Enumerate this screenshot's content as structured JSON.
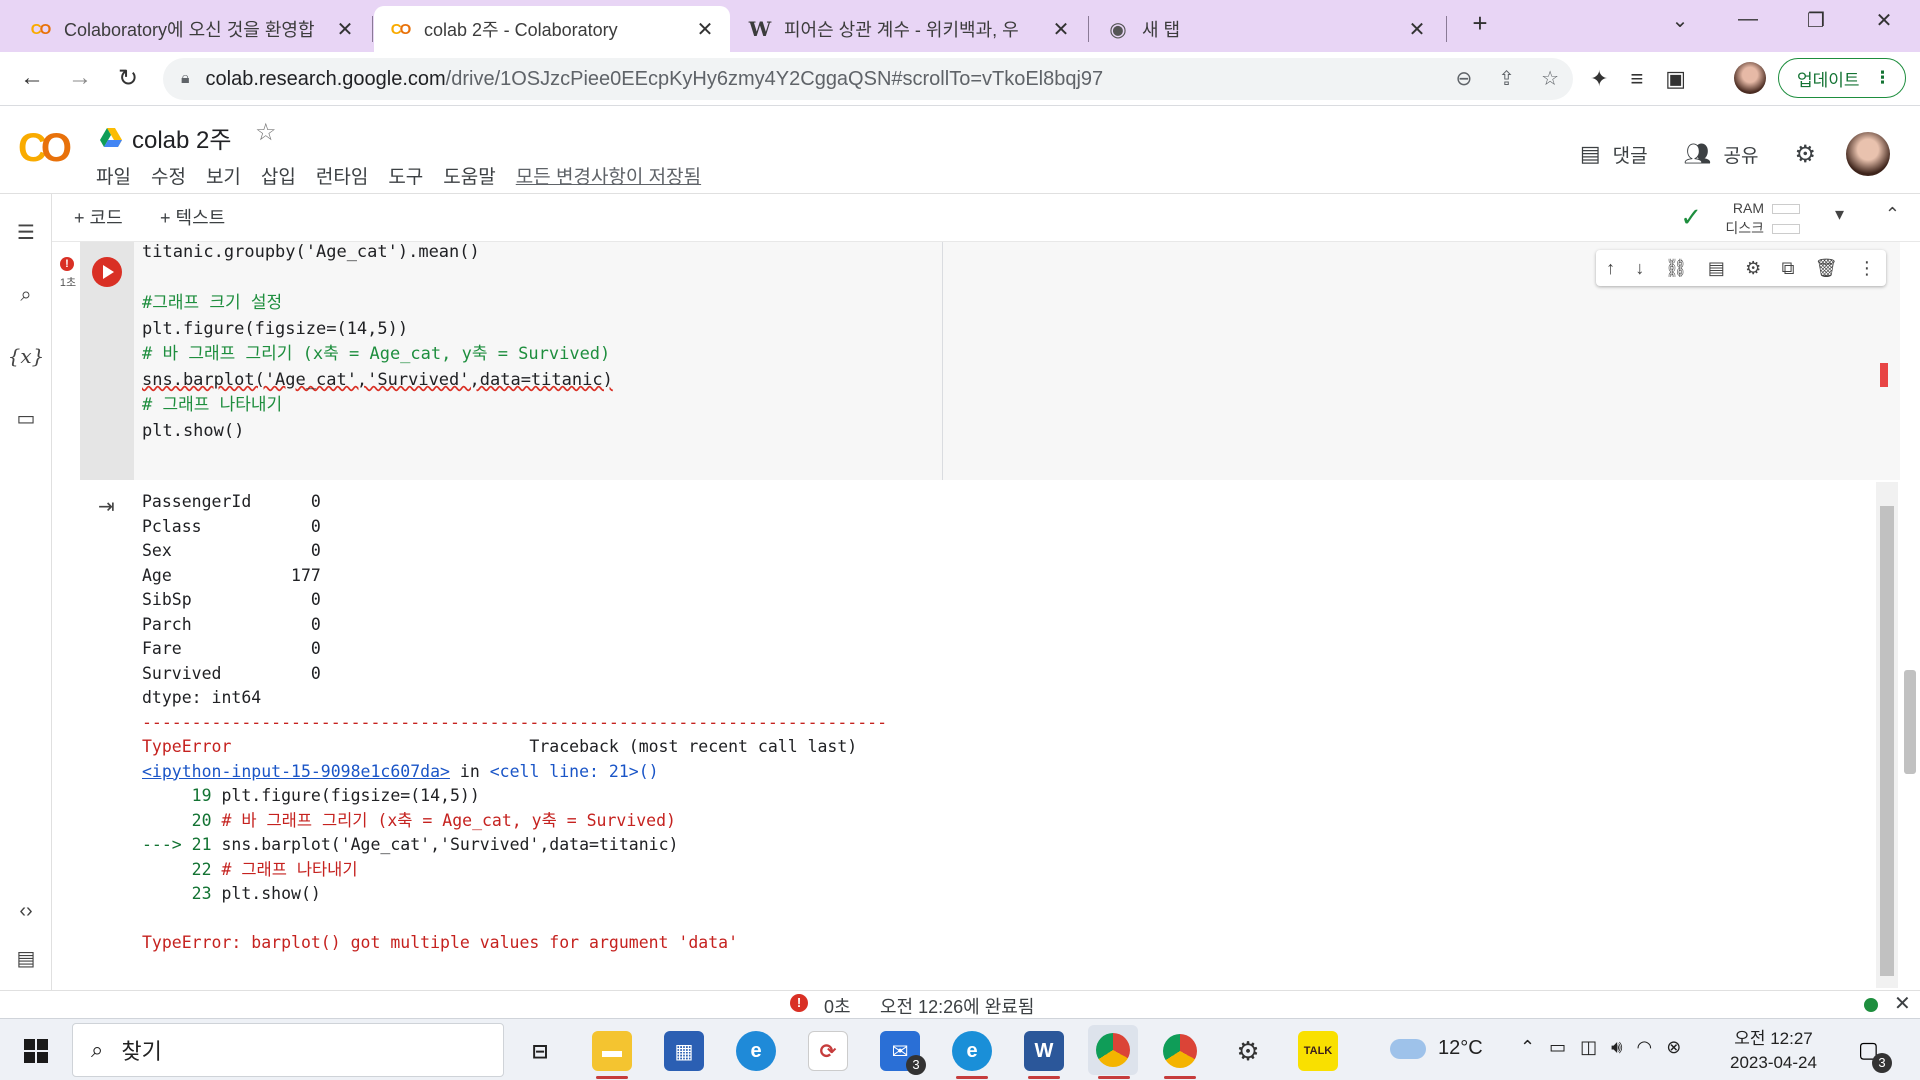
{
  "browser": {
    "tabs": [
      {
        "title": "Colaboratory에 오신 것을 환영합",
        "favicon": "colab-icon",
        "active": false
      },
      {
        "title": "colab 2주 - Colaboratory",
        "favicon": "colab-icon",
        "active": true
      },
      {
        "title": "피어슨 상관 계수 - 위키백과, 우",
        "favicon": "wikipedia-icon",
        "active": false
      },
      {
        "title": "새 탭",
        "favicon": "chrome-icon",
        "active": false
      }
    ],
    "url_host": "colab.research.google.com",
    "url_path": "/drive/1OSJzcPiee0EEcpKyHy6zmy4Y2CggaQSN#scrollTo=vTkoEl8bqj97",
    "update_label": "업데이트"
  },
  "colab": {
    "logo": "CO",
    "notebook_title": "colab 2주",
    "menu": [
      "파일",
      "수정",
      "보기",
      "삽입",
      "런타임",
      "도구",
      "도움말"
    ],
    "saved_status": "모든 변경사항이 저장됨",
    "comment_label": "댓글",
    "share_label": "공유",
    "add_code": "+ 코드",
    "add_text": "+ 텍스트",
    "ram_label": "RAM",
    "disk_label": "디스크"
  },
  "cell": {
    "exec_time": "1초",
    "code_lines": [
      "titanic.groupby('Age_cat').mean()",
      "",
      "#그래프 크기 설정",
      "plt.figure(figsize=(14,5))",
      "# 바 그래프 그리기 (x축 = Age_cat, y축 = Survived)",
      "sns.barplot('Age_cat','Survived',data=titanic)",
      "# 그래프 나타내기",
      "plt.show()"
    ]
  },
  "output": {
    "series_rows": [
      {
        "name": "PassengerId",
        "value": "0"
      },
      {
        "name": "Pclass",
        "value": "0"
      },
      {
        "name": "Sex",
        "value": "0"
      },
      {
        "name": "Age",
        "value": "177"
      },
      {
        "name": "SibSp",
        "value": "0"
      },
      {
        "name": "Parch",
        "value": "0"
      },
      {
        "name": "Fare",
        "value": "0"
      },
      {
        "name": "Survived",
        "value": "0"
      }
    ],
    "dtype": "dtype: int64",
    "dashes": "---------------------------------------------------------------------------",
    "error_type": "TypeError",
    "traceback_header": "Traceback (most recent call last)",
    "input_link": "<ipython-input-15-9098e1c607da>",
    "in_text": "in",
    "cell_line": "<cell line: 21>()",
    "tb_lines": [
      {
        "prefix": "     19 ",
        "code": "plt.figure(figsize=(14,5))"
      },
      {
        "prefix": "     20 ",
        "code": "# 바 그래프 그리기 (x축 = Age_cat, y축 = Survived)"
      },
      {
        "prefix": "---> 21 ",
        "code": "sns.barplot('Age_cat','Survived',data=titanic)"
      },
      {
        "prefix": "     22 ",
        "code": "# 그래프 나타내기"
      },
      {
        "prefix": "     23 ",
        "code": "plt.show()"
      }
    ],
    "error_message": "TypeError: barplot() got multiple values for argument 'data'"
  },
  "status": {
    "seconds": "0초",
    "completed": "오전 12:26에 완료됨"
  },
  "taskbar": {
    "search_label": "찾기",
    "weather": "12°C",
    "time": "오전 12:27",
    "date": "2023-04-24",
    "mail_badge": "3",
    "notif_badge": "3"
  },
  "colors": {
    "tabstrip": "#e8d5f5",
    "error_red": "#d93025",
    "colab_orange": "#f9ab00"
  }
}
